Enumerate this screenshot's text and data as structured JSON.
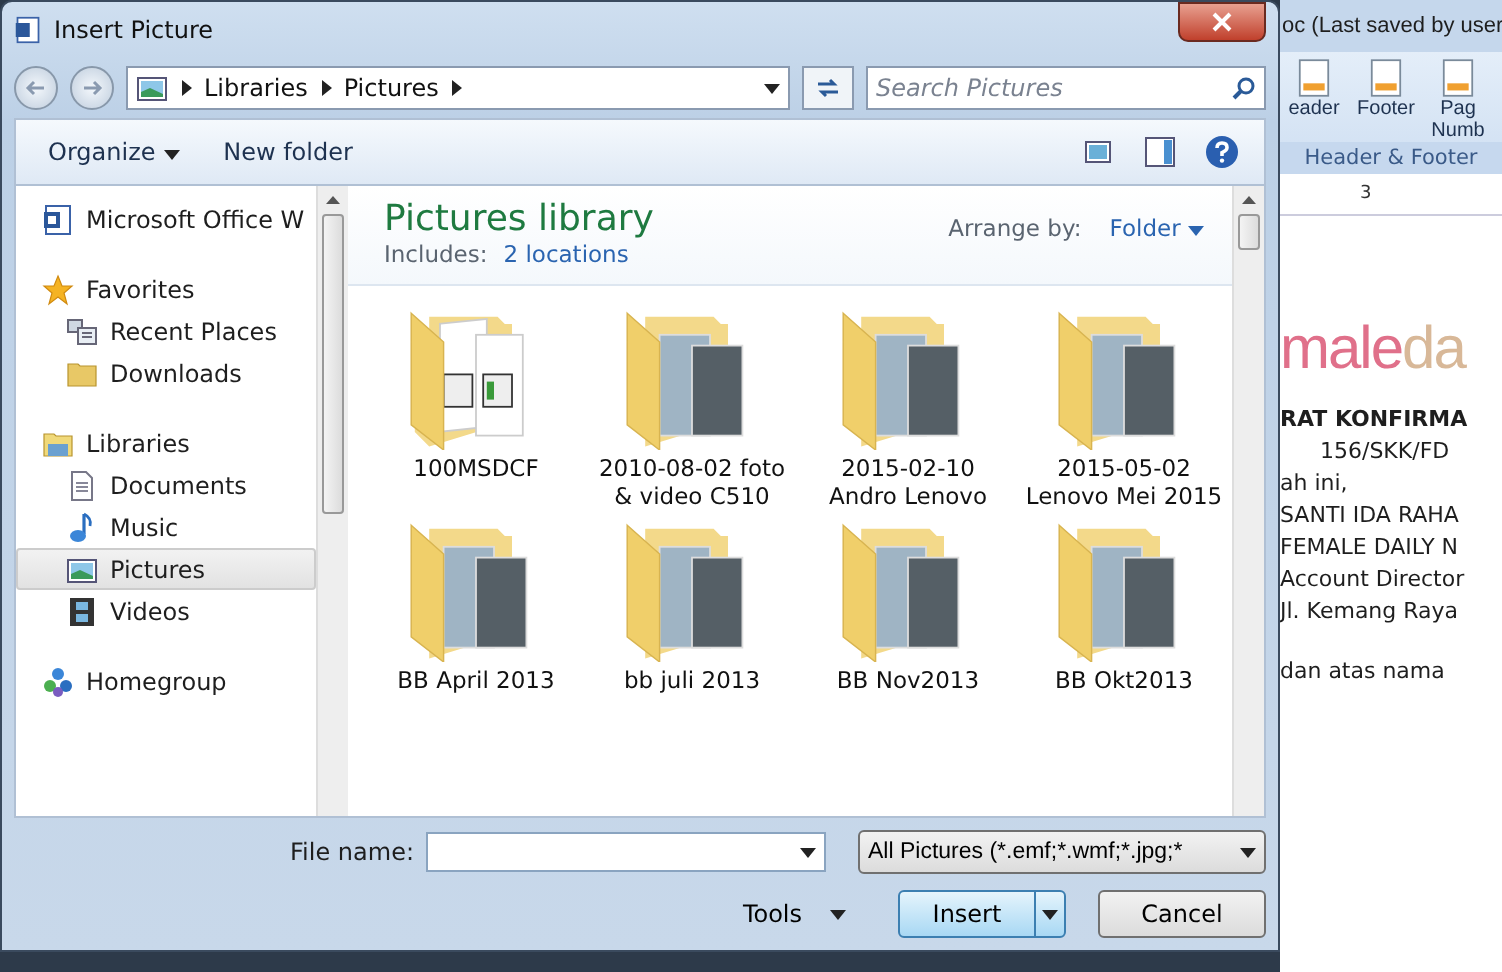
{
  "dialog": {
    "title": "Insert Picture",
    "address": [
      "Libraries",
      "Pictures"
    ],
    "search": {
      "placeholder": "Search Pictures"
    },
    "toolbar": {
      "organize": "Organize",
      "new_folder": "New folder"
    },
    "nav": [
      {
        "label": "Microsoft Office W",
        "selected": false
      },
      {
        "label": "Favorites",
        "selected": false,
        "children": [
          {
            "label": "Recent Places",
            "selected": false
          },
          {
            "label": "Downloads",
            "selected": false
          }
        ]
      },
      {
        "label": "Libraries",
        "selected": false,
        "children": [
          {
            "label": "Documents",
            "selected": false
          },
          {
            "label": "Music",
            "selected": false
          },
          {
            "label": "Pictures",
            "selected": true
          },
          {
            "label": "Videos",
            "selected": false
          }
        ]
      },
      {
        "label": "Homegroup",
        "selected": false
      }
    ],
    "library": {
      "title": "Pictures library",
      "includes_label": "Includes:",
      "includes_link": "2 locations",
      "arrange_label": "Arrange by:",
      "arrange_value": "Folder"
    },
    "folders": [
      {
        "name": "100MSDCF",
        "kind": "calendar"
      },
      {
        "name": "2010-08-02 foto & video C510",
        "kind": "photo"
      },
      {
        "name": "2015-02-10 Andro Lenovo",
        "kind": "photo"
      },
      {
        "name": "2015-05-02 Lenovo Mei 2015",
        "kind": "photo"
      },
      {
        "name": "BB April 2013",
        "kind": "photo"
      },
      {
        "name": "bb juli 2013",
        "kind": "photo"
      },
      {
        "name": "BB Nov2013",
        "kind": "photo"
      },
      {
        "name": "BB Okt2013",
        "kind": "photo"
      }
    ],
    "file_name": {
      "label": "File name:"
    },
    "file_type": "All Pictures (*.emf;*.wmf;*.jpg;*",
    "tools": "Tools",
    "insert": "Insert",
    "cancel": "Cancel"
  },
  "background_window": {
    "title": "oc (Last saved by user",
    "ribbon_buttons": [
      "eader",
      "Footer",
      "Pag Numb"
    ],
    "ribbon_group": "Header & Footer",
    "ruler_mark": "3",
    "logo": [
      {
        "text": "male",
        "color": "#e0708a"
      },
      {
        "text": "da",
        "color": "#d8b898"
      }
    ],
    "lines": [
      {
        "text": "RAT KONFIRMA",
        "kind": "bold"
      },
      {
        "text": "156/SKK/FD",
        "kind": "indent"
      },
      {
        "text": "ah ini,",
        "kind": "plain"
      },
      {
        "text": "SANTI IDA RAHA",
        "kind": "plain"
      },
      {
        "text": "FEMALE DAILY N",
        "kind": "plain"
      },
      {
        "text": "Account Director",
        "kind": "plain"
      },
      {
        "text": "Jl. Kemang Raya",
        "kind": "plain"
      },
      {
        "text": "dan atas nama",
        "kind": "gap"
      }
    ]
  }
}
